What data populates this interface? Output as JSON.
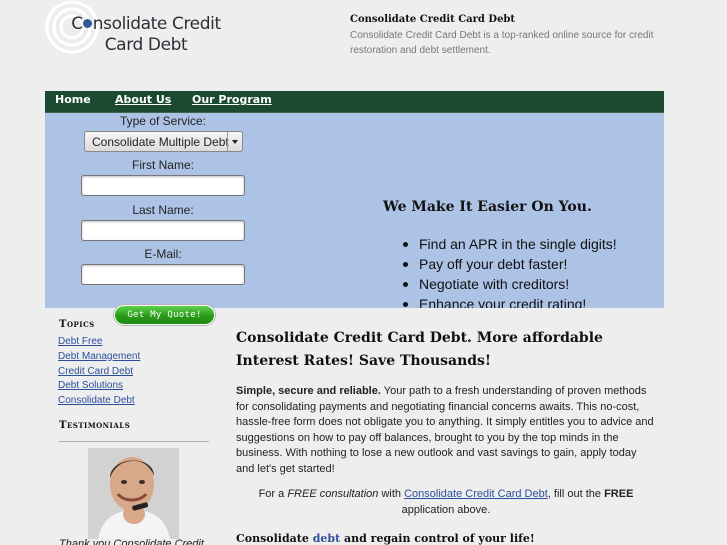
{
  "header": {
    "logo_line1_prefix": "C",
    "logo_line1_suffix": "nsolidate Credit",
    "logo_line2": "Card Debt",
    "tagline_title": "Consolidate Credit Card Debt",
    "tagline_text": "Consolidate Credit Card Debt is a top-ranked online source for credit restoration and debt settlement."
  },
  "colors": {
    "nav_bg": "#1b4a30",
    "hero_bg": "#adc3e5",
    "link": "#2a4f9a",
    "button_green": "#2a9a1a",
    "page_bg": "#eeeeee"
  },
  "nav": {
    "items": [
      {
        "label": "Home"
      },
      {
        "label": "About Us"
      },
      {
        "label": "Our Program"
      }
    ]
  },
  "form": {
    "service_label": "Type of Service:",
    "service_value": "Consolidate Multiple Debt",
    "first_name_label": "First Name:",
    "first_name_value": "",
    "last_name_label": "Last Name:",
    "last_name_value": "",
    "email_label": "E-Mail:",
    "email_value": "",
    "submit_label": "Get My Quote!"
  },
  "hero": {
    "title": "We Make It Easier On You.",
    "bullets": [
      "Find an APR in the single digits!",
      "Pay off your debt faster!",
      "Negotiate with creditors!",
      "Enhance your credit rating!"
    ]
  },
  "sidebar": {
    "topics_heading": "Topics",
    "topics": [
      {
        "label": "Debt Free"
      },
      {
        "label": "Debt Management"
      },
      {
        "label": "Credit Card Debt"
      },
      {
        "label": "Debt Solutions"
      },
      {
        "label": "Consolidate Debt"
      }
    ],
    "testimonials_heading": "Testimonials",
    "testimonial_caption": "Thank you Consolidate Credit"
  },
  "main": {
    "title": "Consolidate Credit Card Debt. More affordable Interest Rates! Save Thousands!",
    "para_bold": "Simple, secure and reliable.",
    "para_text": " Your path to a fresh understanding of proven methods for consolidating payments and negotiating financial concerns awaits. This no-cost, hassle-free form does not obligate you to anything. It simply entitles you to advice and suggestions on how to pay off balances, brought to you by the top minds in the business. With nothing to lose a new outlook and vast savings to gain, apply today and let's get started!",
    "cta_prefix": "For a ",
    "cta_free_italic": "FREE consultation",
    "cta_with": " with ",
    "cta_link": "Consolidate Credit Card Debt",
    "cta_middle": ", fill out the ",
    "cta_free_bold": "FREE",
    "cta_suffix": " application above.",
    "bottom_prefix": "Consolidate ",
    "bottom_link": "debt",
    "bottom_suffix": " and regain control of your life!"
  }
}
